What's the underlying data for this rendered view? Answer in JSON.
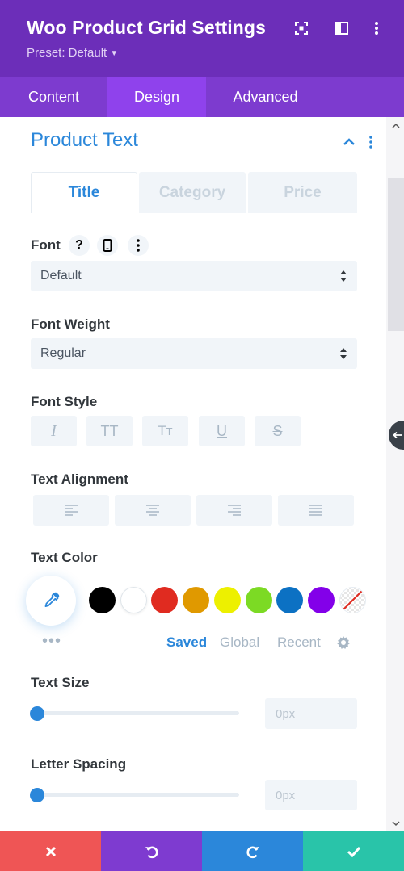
{
  "header": {
    "title": "Woo Product Grid Settings",
    "preset": "Preset: Default",
    "icons": [
      "fullscreen-icon",
      "split-view-icon",
      "more-vertical-icon"
    ]
  },
  "tabs": [
    {
      "label": "Content",
      "active": false
    },
    {
      "label": "Design",
      "active": true
    },
    {
      "label": "Advanced",
      "active": false
    }
  ],
  "section": {
    "title": "Product Text",
    "subtabs": [
      {
        "label": "Title",
        "active": true
      },
      {
        "label": "Category",
        "active": false
      },
      {
        "label": "Price",
        "active": false
      }
    ]
  },
  "font": {
    "label": "Font",
    "help_icon": "?",
    "value": "Default"
  },
  "font_weight": {
    "label": "Font Weight",
    "value": "Regular"
  },
  "font_style": {
    "label": "Font Style",
    "buttons": [
      {
        "name": "italic",
        "glyph": "I"
      },
      {
        "name": "uppercase",
        "glyph": "TT"
      },
      {
        "name": "capitalize",
        "glyph": "Tт"
      },
      {
        "name": "underline",
        "glyph": "U"
      },
      {
        "name": "strikethrough",
        "glyph": "S"
      }
    ]
  },
  "text_alignment": {
    "label": "Text Alignment",
    "options": [
      "left",
      "center",
      "right",
      "justify"
    ]
  },
  "text_color": {
    "label": "Text Color",
    "swatches": [
      "#000000",
      "#ffffff",
      "#e02b20",
      "#e09900",
      "#edf000",
      "#7cda24",
      "#0c71c3",
      "#8300e9"
    ],
    "more": "•••",
    "palette_tabs": [
      {
        "label": "Saved",
        "active": true
      },
      {
        "label": "Global",
        "active": false
      },
      {
        "label": "Recent",
        "active": false
      }
    ]
  },
  "text_size": {
    "label": "Text Size",
    "value": "0px",
    "fraction": 0
  },
  "letter_spacing": {
    "label": "Letter Spacing",
    "value": "0px",
    "fraction": 0
  },
  "colors": {
    "header_bg": "#6c2eb9",
    "tabs_bg": "#7d3bcf",
    "tab_active_bg": "#8f42ec",
    "accent": "#2b87da",
    "cancel": "#ef5555",
    "undo": "#7e3bd0",
    "redo": "#2b87da",
    "save": "#29c4a9"
  },
  "bottom_bar": [
    "cancel-icon",
    "undo-icon",
    "redo-icon",
    "save-check-icon"
  ]
}
